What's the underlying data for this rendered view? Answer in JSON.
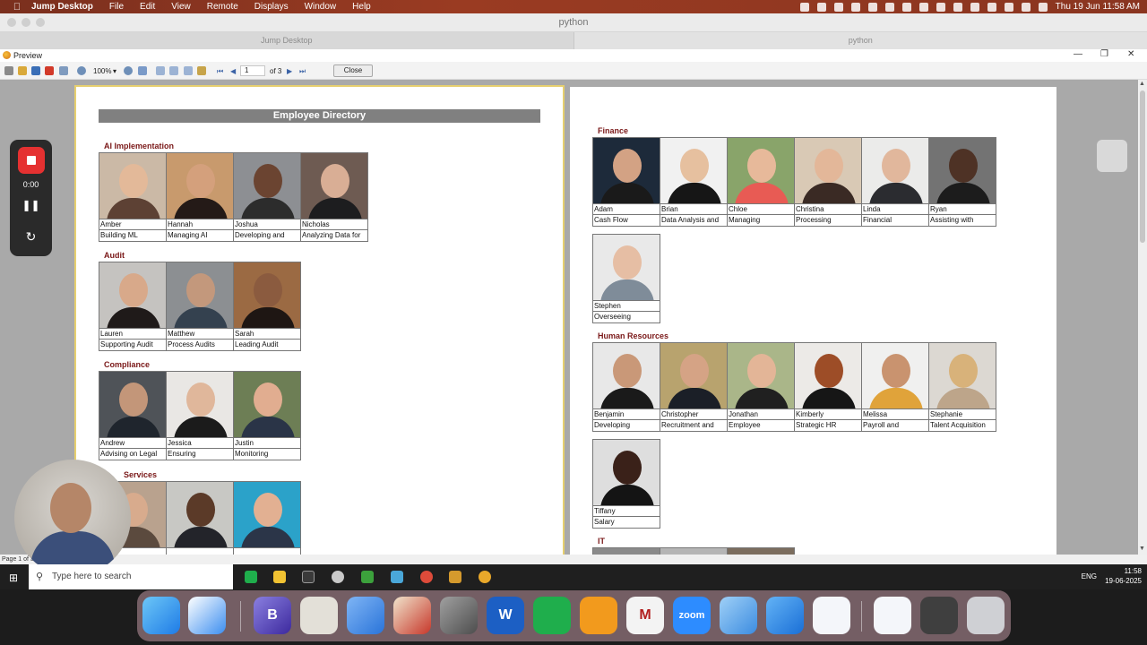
{
  "mac_menubar": {
    "apple_icon": "apple-icon",
    "app_name": "Jump Desktop",
    "menus": [
      "File",
      "Edit",
      "View",
      "Remote",
      "Displays",
      "Window",
      "Help"
    ],
    "clock": "Thu 19 Jun  11:58 AM"
  },
  "jump_window": {
    "title": "python",
    "tabs": [
      "Jump Desktop",
      "python"
    ]
  },
  "preview": {
    "title": "Preview",
    "zoom": "100%",
    "page_input": "1",
    "page_of": "of 3",
    "close_label": "Close",
    "status": "Page 1 of 3"
  },
  "directory": {
    "title": "Employee Directory",
    "departments": [
      {
        "name": "AI Implementation",
        "people": [
          {
            "name": "Amber",
            "role": "Building ML"
          },
          {
            "name": "Hannah",
            "role": "Managing AI"
          },
          {
            "name": "Joshua",
            "role": "Developing and"
          },
          {
            "name": "Nicholas",
            "role": "Analyzing Data for"
          }
        ]
      },
      {
        "name": "Audit",
        "people": [
          {
            "name": "Lauren",
            "role": "Supporting Audit"
          },
          {
            "name": "Matthew",
            "role": "Process Audits"
          },
          {
            "name": "Sarah",
            "role": "Leading Audit"
          }
        ]
      },
      {
        "name": "Compliance",
        "people": [
          {
            "name": "Andrew",
            "role": "Advising on Legal"
          },
          {
            "name": "Jessica",
            "role": "Ensuring"
          },
          {
            "name": "Justin",
            "role": "Monitoring"
          }
        ]
      },
      {
        "name": "Services",
        "people": [
          {
            "name": "",
            "role": ""
          },
          {
            "name": "",
            "role": ""
          },
          {
            "name": "",
            "role": ""
          }
        ]
      },
      {
        "name": "Finance",
        "people": [
          {
            "name": "Adam",
            "role": "Cash Flow"
          },
          {
            "name": "Brian",
            "role": "Data Analysis and"
          },
          {
            "name": "Chloe",
            "role": "Managing"
          },
          {
            "name": "Christina",
            "role": "Processing"
          },
          {
            "name": "Linda",
            "role": "Financial"
          },
          {
            "name": "Ryan",
            "role": "Assisting with"
          },
          {
            "name": "Stephen",
            "role": "Overseeing"
          }
        ]
      },
      {
        "name": "Human Resources",
        "people": [
          {
            "name": "Benjamin",
            "role": "Developing"
          },
          {
            "name": "Christopher",
            "role": "Recruitment and"
          },
          {
            "name": "Jonathan",
            "role": "Employee"
          },
          {
            "name": "Kimberly",
            "role": "Strategic HR"
          },
          {
            "name": "Melissa",
            "role": "Payroll and"
          },
          {
            "name": "Stephanie",
            "role": "Talent Acquisition"
          },
          {
            "name": "Tiffany",
            "role": "Salary"
          }
        ]
      },
      {
        "name": "IT",
        "people": []
      }
    ]
  },
  "recorder": {
    "time": "0:00"
  },
  "taskbar": {
    "search_placeholder": "Type here to search",
    "language": "ENG",
    "time": "11:58",
    "date": "19-06-2025"
  },
  "dock": {
    "zoom_label": "zoom"
  }
}
